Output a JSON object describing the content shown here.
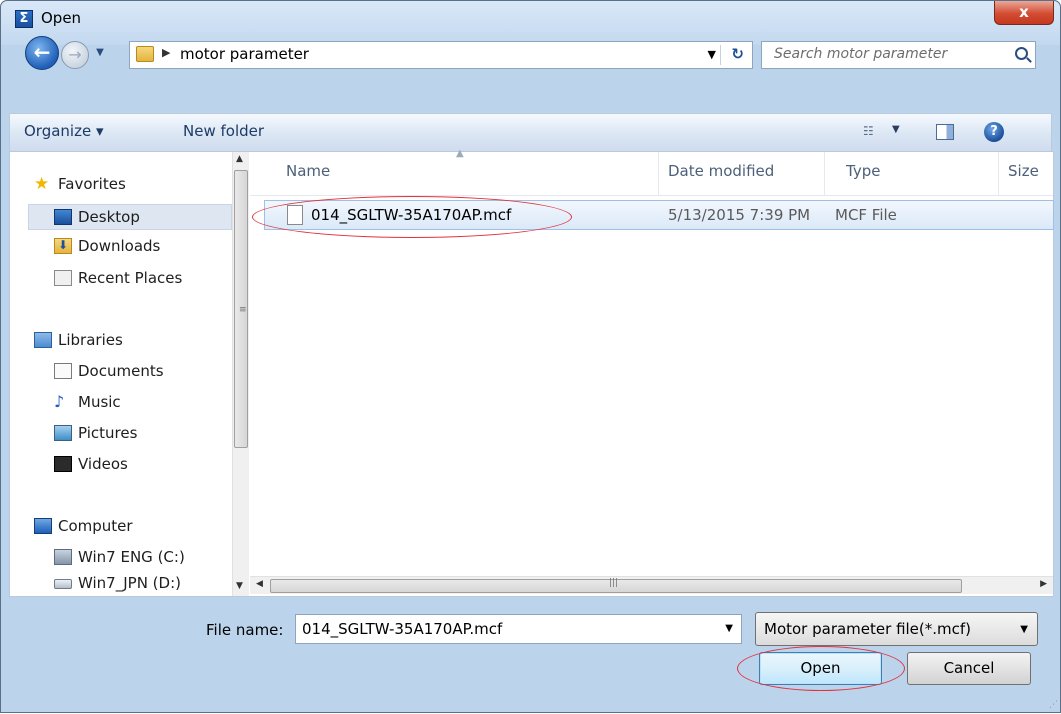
{
  "window": {
    "title": "Open",
    "app_icon": "sigma-app-icon",
    "close_glyph": "x"
  },
  "navigation": {
    "back_glyph": "←",
    "forward_glyph": "→",
    "breadcrumb": "motor parameter",
    "search_placeholder": "Search motor parameter"
  },
  "toolbar": {
    "organize_label": "Organize ▾",
    "new_folder_label": "New folder",
    "help_glyph": "?"
  },
  "sidebar": {
    "items": [
      {
        "label": "Favorites",
        "icon": "star-icon",
        "group": true
      },
      {
        "label": "Desktop",
        "icon": "desktop-icon",
        "selected": true
      },
      {
        "label": "Downloads",
        "icon": "downloads-icon"
      },
      {
        "label": "Recent Places",
        "icon": "recent-places-icon"
      },
      {
        "label": "Libraries",
        "icon": "libraries-icon",
        "group": true
      },
      {
        "label": "Documents",
        "icon": "documents-icon"
      },
      {
        "label": "Music",
        "icon": "music-icon"
      },
      {
        "label": "Pictures",
        "icon": "pictures-icon"
      },
      {
        "label": "Videos",
        "icon": "videos-icon"
      },
      {
        "label": "Computer",
        "icon": "computer-icon",
        "group": true
      },
      {
        "label": "Win7 ENG (C:)",
        "icon": "drive-c-icon"
      },
      {
        "label": "Win7_JPN (D:)",
        "icon": "drive-d-icon"
      }
    ]
  },
  "file_list": {
    "columns": [
      "Name",
      "Date modified",
      "Type",
      "Size"
    ],
    "files": [
      {
        "name": "014_SGLTW-35A170AP.mcf",
        "date_modified": "5/13/2015 7:39 PM",
        "type": "MCF File",
        "size": ""
      }
    ]
  },
  "footer": {
    "file_name_label": "File name:",
    "file_name_value": "014_SGLTW-35A170AP.mcf",
    "filter_value": "Motor parameter file(*.mcf)",
    "open_label": "Open",
    "cancel_label": "Cancel"
  },
  "annotations": {
    "highlight_color": "#e0323c"
  }
}
